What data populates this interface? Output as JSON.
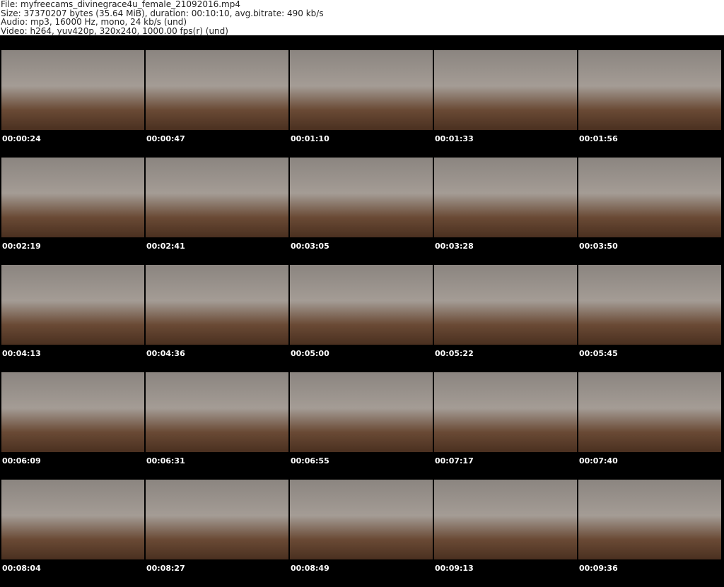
{
  "header": {
    "file": "File: myfreecams_divinegrace4u_female_21092016.mp4",
    "size": "Size: 37370207 bytes (35.64 MiB), duration: 00:10:10, avg.bitrate: 490 kb/s",
    "audio": "Audio: mp3, 16000 Hz, mono, 24 kb/s (und)",
    "video": "Video: h264, yuv420p, 320x240, 1000.00 fps(r) (und)"
  },
  "thumbnails": [
    "00:00:24",
    "00:00:47",
    "00:01:10",
    "00:01:33",
    "00:01:56",
    "00:02:19",
    "00:02:41",
    "00:03:05",
    "00:03:28",
    "00:03:50",
    "00:04:13",
    "00:04:36",
    "00:05:00",
    "00:05:22",
    "00:05:45",
    "00:06:09",
    "00:06:31",
    "00:06:55",
    "00:07:17",
    "00:07:40",
    "00:08:04",
    "00:08:27",
    "00:08:49",
    "00:09:13",
    "00:09:36"
  ]
}
